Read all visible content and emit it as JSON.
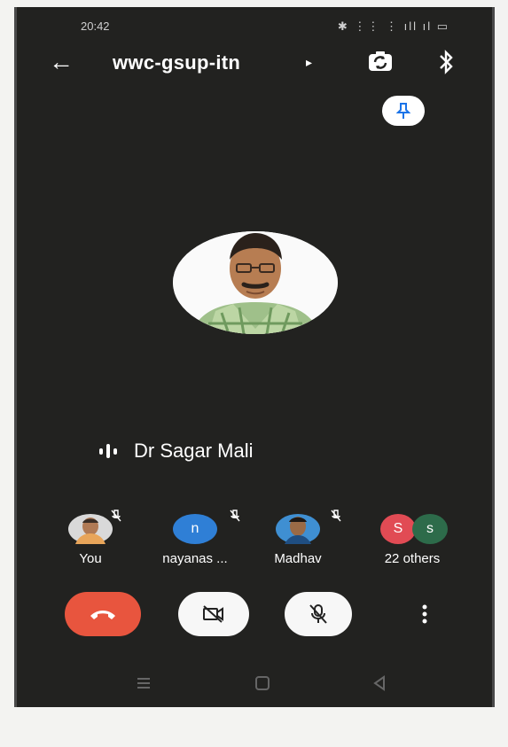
{
  "status_bar": {
    "time": "20:42",
    "icons_text": "✱ ⋮⋮ ⋮ ıll ıl ▭"
  },
  "header": {
    "title": "wwc-gsup-itn",
    "caret": "▸",
    "back_icon": "arrow-left-icon",
    "flip_icon": "switch-camera-icon",
    "bluetooth_icon": "bluetooth-icon"
  },
  "pin": {
    "icon": "pin-icon"
  },
  "speaker": {
    "name": "Dr Sagar Mali"
  },
  "participants": [
    {
      "label": "You",
      "avatar_text": "",
      "color": "#d9d9d9",
      "muted": true
    },
    {
      "label": "nayanas ...",
      "avatar_text": "n",
      "color": "#2f7fd6",
      "muted": true
    },
    {
      "label": "Madhav",
      "avatar_text": "",
      "color": "#3f8fd2",
      "muted": true
    },
    {
      "label": "22 others",
      "avatar_text": "S",
      "color": "#e14b54",
      "second_text": "s",
      "second_color": "#2d6b4a",
      "muted": false
    }
  ],
  "controls": {
    "end_icon": "end-call-icon",
    "camera_icon": "camera-off-icon",
    "mic_icon": "mic-off-icon",
    "more_icon": "more-vert-icon"
  },
  "colors": {
    "background": "#222220",
    "end_call": "#e8553e"
  }
}
